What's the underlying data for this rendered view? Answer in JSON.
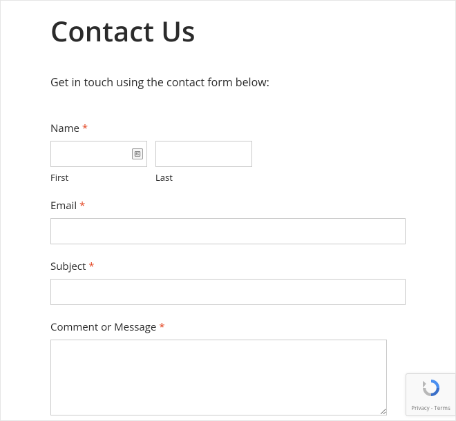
{
  "page": {
    "title": "Contact Us",
    "intro": "Get in touch using the contact form below:"
  },
  "form": {
    "name": {
      "label": "Name",
      "required": "*",
      "first": {
        "sublabel": "First",
        "value": ""
      },
      "last": {
        "sublabel": "Last",
        "value": ""
      }
    },
    "email": {
      "label": "Email",
      "required": "*",
      "value": ""
    },
    "subject": {
      "label": "Subject",
      "required": "*",
      "value": ""
    },
    "message": {
      "label": "Comment or Message",
      "required": "*",
      "value": ""
    }
  },
  "recaptcha": {
    "privacy_terms": "Privacy - Terms"
  }
}
